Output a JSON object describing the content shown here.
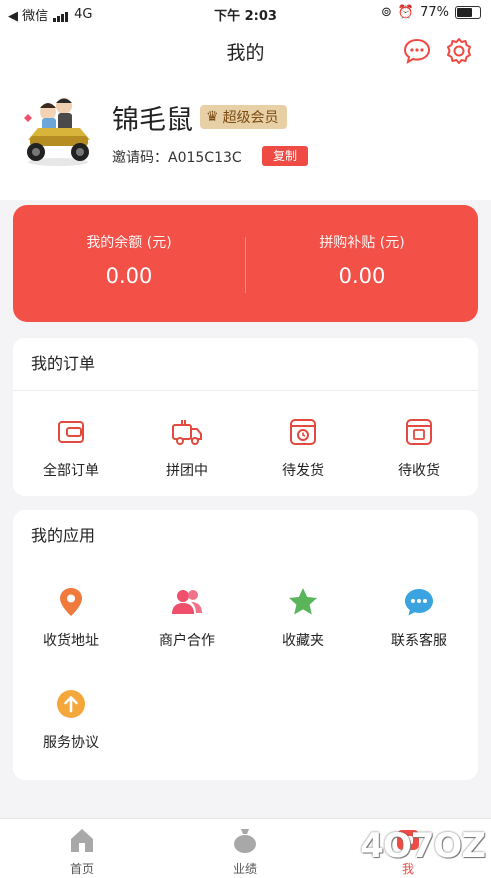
{
  "status_bar": {
    "carrier": "◀ 微信",
    "network": "4G",
    "time": "下午 2:03",
    "battery": "77%",
    "battery_level": 0.77
  },
  "header": {
    "title": "我的"
  },
  "profile": {
    "nickname": "锦毛鼠",
    "vip_badge": "超级会员",
    "invite_label": "邀请码：",
    "invite_code": "A015C13C",
    "copy_button": "复制"
  },
  "balance": {
    "left_label": "我的余额 (元)",
    "left_value": "0.00",
    "right_label": "拼购补贴 (元)",
    "right_value": "0.00"
  },
  "orders": {
    "title": "我的订单",
    "items": [
      {
        "label": "全部订单",
        "icon": "wallet-icon"
      },
      {
        "label": "拼团中",
        "icon": "truck-icon"
      },
      {
        "label": "待发货",
        "icon": "package-clock-icon"
      },
      {
        "label": "待收货",
        "icon": "box-icon"
      }
    ]
  },
  "apps": {
    "title": "我的应用",
    "items": [
      {
        "label": "收货地址",
        "icon": "location-pin-icon",
        "color": "#f07a3c"
      },
      {
        "label": "商户合作",
        "icon": "users-icon",
        "color": "#ef4f6a"
      },
      {
        "label": "收藏夹",
        "icon": "star-icon",
        "color": "#5ab45a"
      },
      {
        "label": "联系客服",
        "icon": "chat-bubble-icon",
        "color": "#3aa3e0"
      },
      {
        "label": "服务协议",
        "icon": "arrow-up-circle-icon",
        "color": "#f4a73a"
      }
    ]
  },
  "tabbar": [
    {
      "label": "首页",
      "icon": "home-icon"
    },
    {
      "label": "业绩",
      "icon": "money-bag-icon"
    },
    {
      "label": "我",
      "icon": "profile-icon"
    }
  ],
  "colors": {
    "accent": "#ef4b44",
    "balance_card": "#f35048"
  },
  "watermark": "4O7OZ"
}
